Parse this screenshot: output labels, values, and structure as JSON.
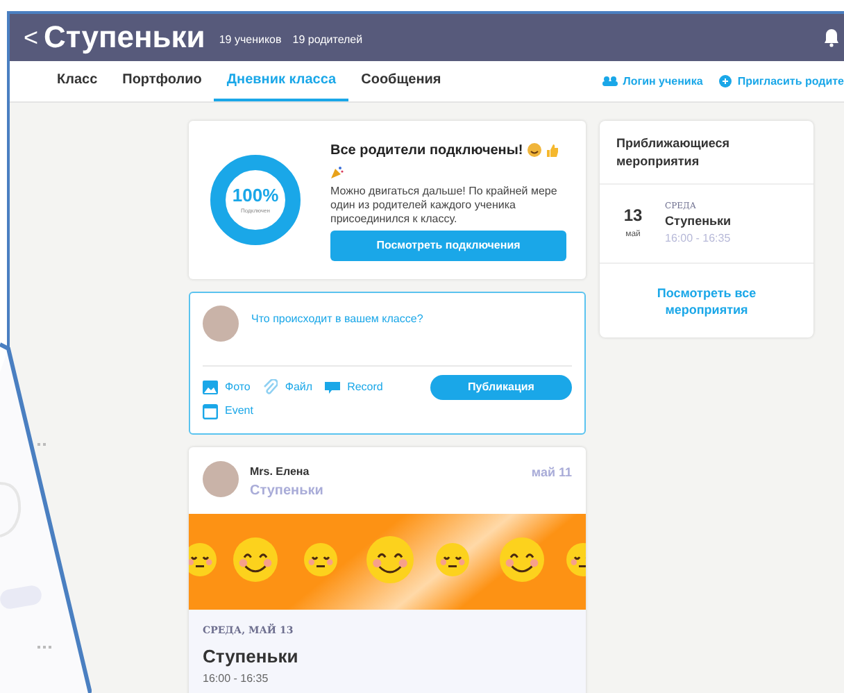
{
  "header": {
    "back": "<",
    "title": "Ступеньки",
    "students": "19 учеников",
    "parents": "19 родителей"
  },
  "tabs": [
    {
      "label": "Класс",
      "selected": false
    },
    {
      "label": "Портфолио",
      "selected": false
    },
    {
      "label": "Дневник класса",
      "selected": true
    },
    {
      "label": "Сообщения",
      "selected": false
    }
  ],
  "nav_links": [
    {
      "kind": "student",
      "label": "Логин ученика"
    },
    {
      "kind": "invite",
      "label": "Пригласить родите"
    }
  ],
  "connections": {
    "level": 1,
    "percent": "100%",
    "caption": "Подключен",
    "title": "Все родители подключены!",
    "text": "Можно двигаться дальше! По крайней мере один из родителей каждого ученика присоединился к классу.",
    "button": "Посмотреть подключения"
  },
  "composer": {
    "placeholder": "Что происходит в вашем классе?",
    "actions": [
      {
        "kind": "photo",
        "label": "Фото"
      },
      {
        "kind": "file",
        "label": "Файл"
      },
      {
        "kind": "record",
        "label": "Record"
      },
      {
        "kind": "event",
        "label": "Event"
      }
    ],
    "publish": "Публикация"
  },
  "post": {
    "author": "Mrs. Елена",
    "class": "Ступеньки",
    "date": "май 11",
    "event_day": "СРЕДА, МАЙ 13",
    "event_title": "Ступеньки",
    "event_time": "16:00 - 16:35"
  },
  "events": {
    "title": "Приближающиеся мероприятия",
    "items": [
      {
        "day": "13",
        "month": "май",
        "weekday": "СРЕДА",
        "name": "Ступеньки",
        "time": "16:00 - 16:35"
      }
    ],
    "more": "Посмотреть все мероприятия"
  }
}
